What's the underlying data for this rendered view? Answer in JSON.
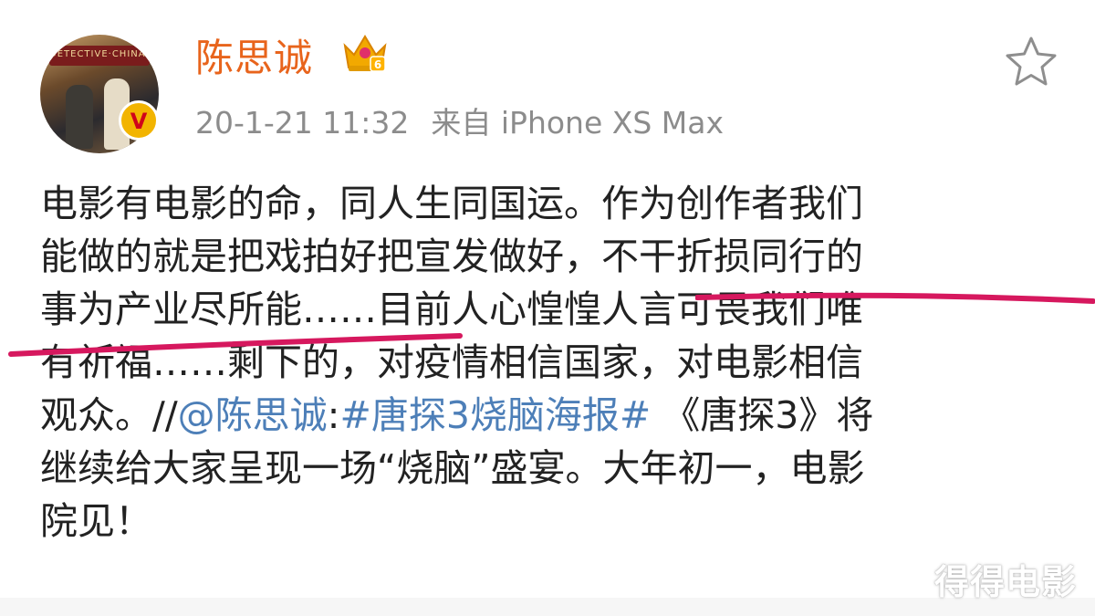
{
  "header": {
    "username": "陈思诚",
    "avatar_sign_text": "DETECTIVE·CHINATOWN",
    "verified_mark": "V",
    "timestamp": "20-1-21 11:32",
    "source": "来自 iPhone XS Max",
    "icons": {
      "crown": "crown-badge-icon",
      "star": "star-favorite-icon",
      "verified": "verified-v-icon"
    }
  },
  "post": {
    "line1": "电影有电影的命，同人生同国运。作为创作者我们",
    "line2": "能做的就是把戏拍好把宣发做好，不干折损同行的",
    "line3": "事为产业尽所能……目前人心惶惶人言可畏我们唯",
    "line4": "有祈福……剩下的，对疫情相信国家，对电影相信",
    "line5_pre": "观众。//",
    "line5_mention": "@陈思诚",
    "line5_colon": ":",
    "line5_hashtag": "#唐探3烧脑海报#",
    "line5_post": " 《唐探3》将",
    "line6": "继续给大家呈现一场“烧脑”盛宴。大年初一，电影",
    "line7": "院见！"
  },
  "watermark": "得得电影",
  "colors": {
    "username": "#e8641c",
    "meta": "#8c8c8c",
    "link": "#4d7fb8",
    "highlight_underline": "#d6185e"
  }
}
